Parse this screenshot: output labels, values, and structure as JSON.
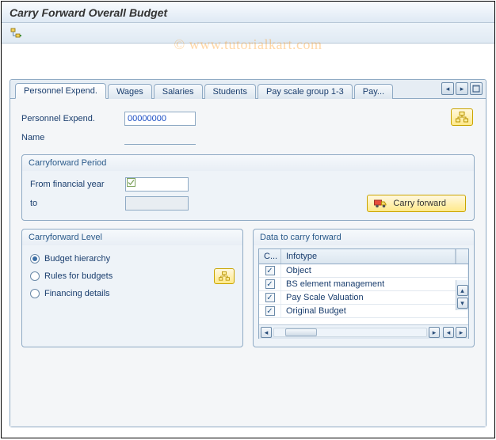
{
  "title": "Carry Forward Overall Budget",
  "watermark": "© www.tutorialkart.com",
  "tabs": {
    "items": [
      "Personnel Expend.",
      "Wages",
      "Salaries",
      "Students",
      "Pay scale group 1-3",
      "Pay..."
    ],
    "active_index": 0
  },
  "fields": {
    "pe_label": "Personnel Expend.",
    "pe_value": "00000000",
    "name_label": "Name",
    "name_value": ""
  },
  "carryforward_period": {
    "title": "Carryforward Period",
    "from_label": "From financial year",
    "from_value": "",
    "to_label": "to",
    "to_value": "",
    "button_label": "Carry forward"
  },
  "carryforward_level": {
    "title": "Carryforward Level",
    "options": [
      {
        "label": "Budget hierarchy",
        "selected": true
      },
      {
        "label": "Rules for budgets",
        "selected": false
      },
      {
        "label": "Financing details",
        "selected": false
      }
    ]
  },
  "data_to_carry": {
    "title": "Data to carry forward",
    "col_chk": "C...",
    "col_txt": "Infotype",
    "rows": [
      {
        "checked": true,
        "label": "Object"
      },
      {
        "checked": true,
        "label": "BS element management"
      },
      {
        "checked": true,
        "label": "Pay Scale Valuation"
      },
      {
        "checked": true,
        "label": "Original Budget"
      }
    ]
  }
}
